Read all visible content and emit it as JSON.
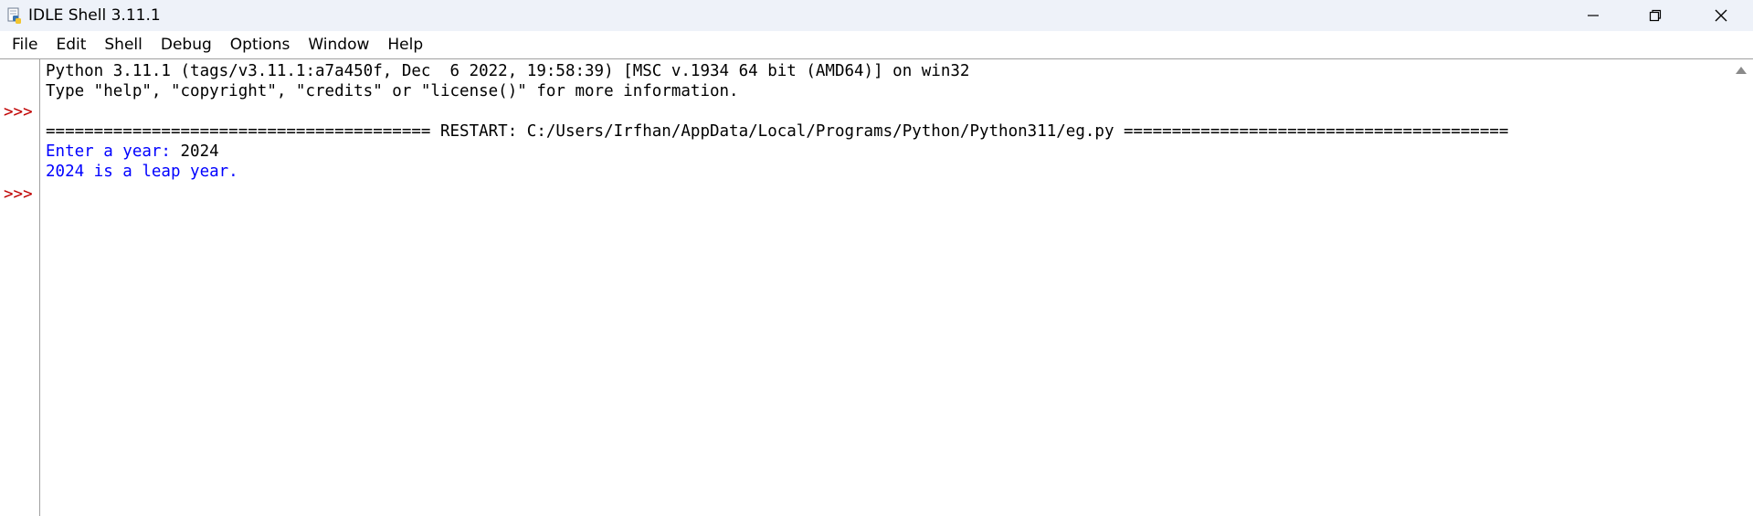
{
  "window": {
    "title": "IDLE Shell 3.11.1",
    "icons": {
      "app": "python-idle-icon",
      "minimize": "minimize-icon",
      "maximize": "restore-icon",
      "close": "close-icon"
    }
  },
  "menu": {
    "items": [
      {
        "label": "File"
      },
      {
        "label": "Edit"
      },
      {
        "label": "Shell"
      },
      {
        "label": "Debug"
      },
      {
        "label": "Options"
      },
      {
        "label": "Window"
      },
      {
        "label": "Help"
      }
    ]
  },
  "shell": {
    "prompt": ">>>",
    "banner_line1": "Python 3.11.1 (tags/v3.11.1:a7a450f, Dec  6 2022, 19:58:39) [MSC v.1934 64 bit (AMD64)] on win32",
    "banner_line2": "Type \"help\", \"copyright\", \"credits\" or \"license()\" for more information.",
    "restart_line": "======================================== RESTART: C:/Users/Irfhan/AppData/Local/Programs/Python/Python311/eg.py ========================================",
    "input_prompt": "Enter a year: ",
    "input_value": "2024",
    "output_line": "2024 is a leap year."
  },
  "colors": {
    "titlebar_bg": "#eef2f9",
    "prompt": "#c00000",
    "stdout": "#0000ff",
    "text": "#000000"
  }
}
